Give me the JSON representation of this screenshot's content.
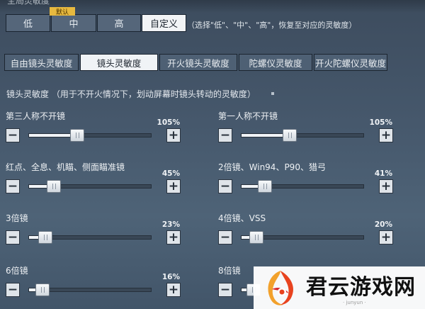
{
  "section_title": "全局灵敏度",
  "presets": {
    "items": [
      {
        "label": "低",
        "active": false
      },
      {
        "label": "中",
        "active": false
      },
      {
        "label": "高",
        "active": false
      },
      {
        "label": "自定义",
        "active": true
      }
    ],
    "default_badge": "默认",
    "hint": "（选择\"低\"、\"中\"、\"高\"，恢复至对应的灵敏度）"
  },
  "tabs": [
    {
      "label": "自由镜头灵敏度",
      "active": false
    },
    {
      "label": "镜头灵敏度",
      "active": true
    },
    {
      "label": "开火镜头灵敏度",
      "active": false
    },
    {
      "label": "陀螺仪灵敏度",
      "active": false
    },
    {
      "label": "开火陀螺仪灵敏度",
      "active": false
    }
  ],
  "description": "镜头灵敏度 （用于不开火情况下，划动屏幕时镜头转动的灵敏度）",
  "sliders": [
    {
      "id": "third-person",
      "label": "第三人称不开镜",
      "percent": "105%",
      "value": 0.333
    },
    {
      "id": "first-person",
      "label": "第一人称不开镜",
      "percent": "105%",
      "value": 0.333
    },
    {
      "id": "red-dot",
      "label": "红点、全息、机瞄、侧面瞄准镜",
      "percent": "45%",
      "value": 0.143
    },
    {
      "id": "2x",
      "label": "2倍镜、Win94、P90、猎弓",
      "percent": "41%",
      "value": 0.13
    },
    {
      "id": "3x",
      "label": "3倍镜",
      "percent": "23%",
      "value": 0.073
    },
    {
      "id": "4x",
      "label": "4倍镜、VSS",
      "percent": "20%",
      "value": 0.063
    },
    {
      "id": "6x",
      "label": "6倍镜",
      "percent": "16%",
      "value": 0.051
    },
    {
      "id": "8x",
      "label": "8倍镜",
      "percent": "",
      "value": 0.04
    }
  ],
  "watermark": {
    "text": "君云游戏网",
    "sub": "· junyun ·"
  },
  "colors": {
    "badge": "#e7b93f",
    "active_bg": "#f2f4f6",
    "panel_bg": "#4e6074"
  }
}
